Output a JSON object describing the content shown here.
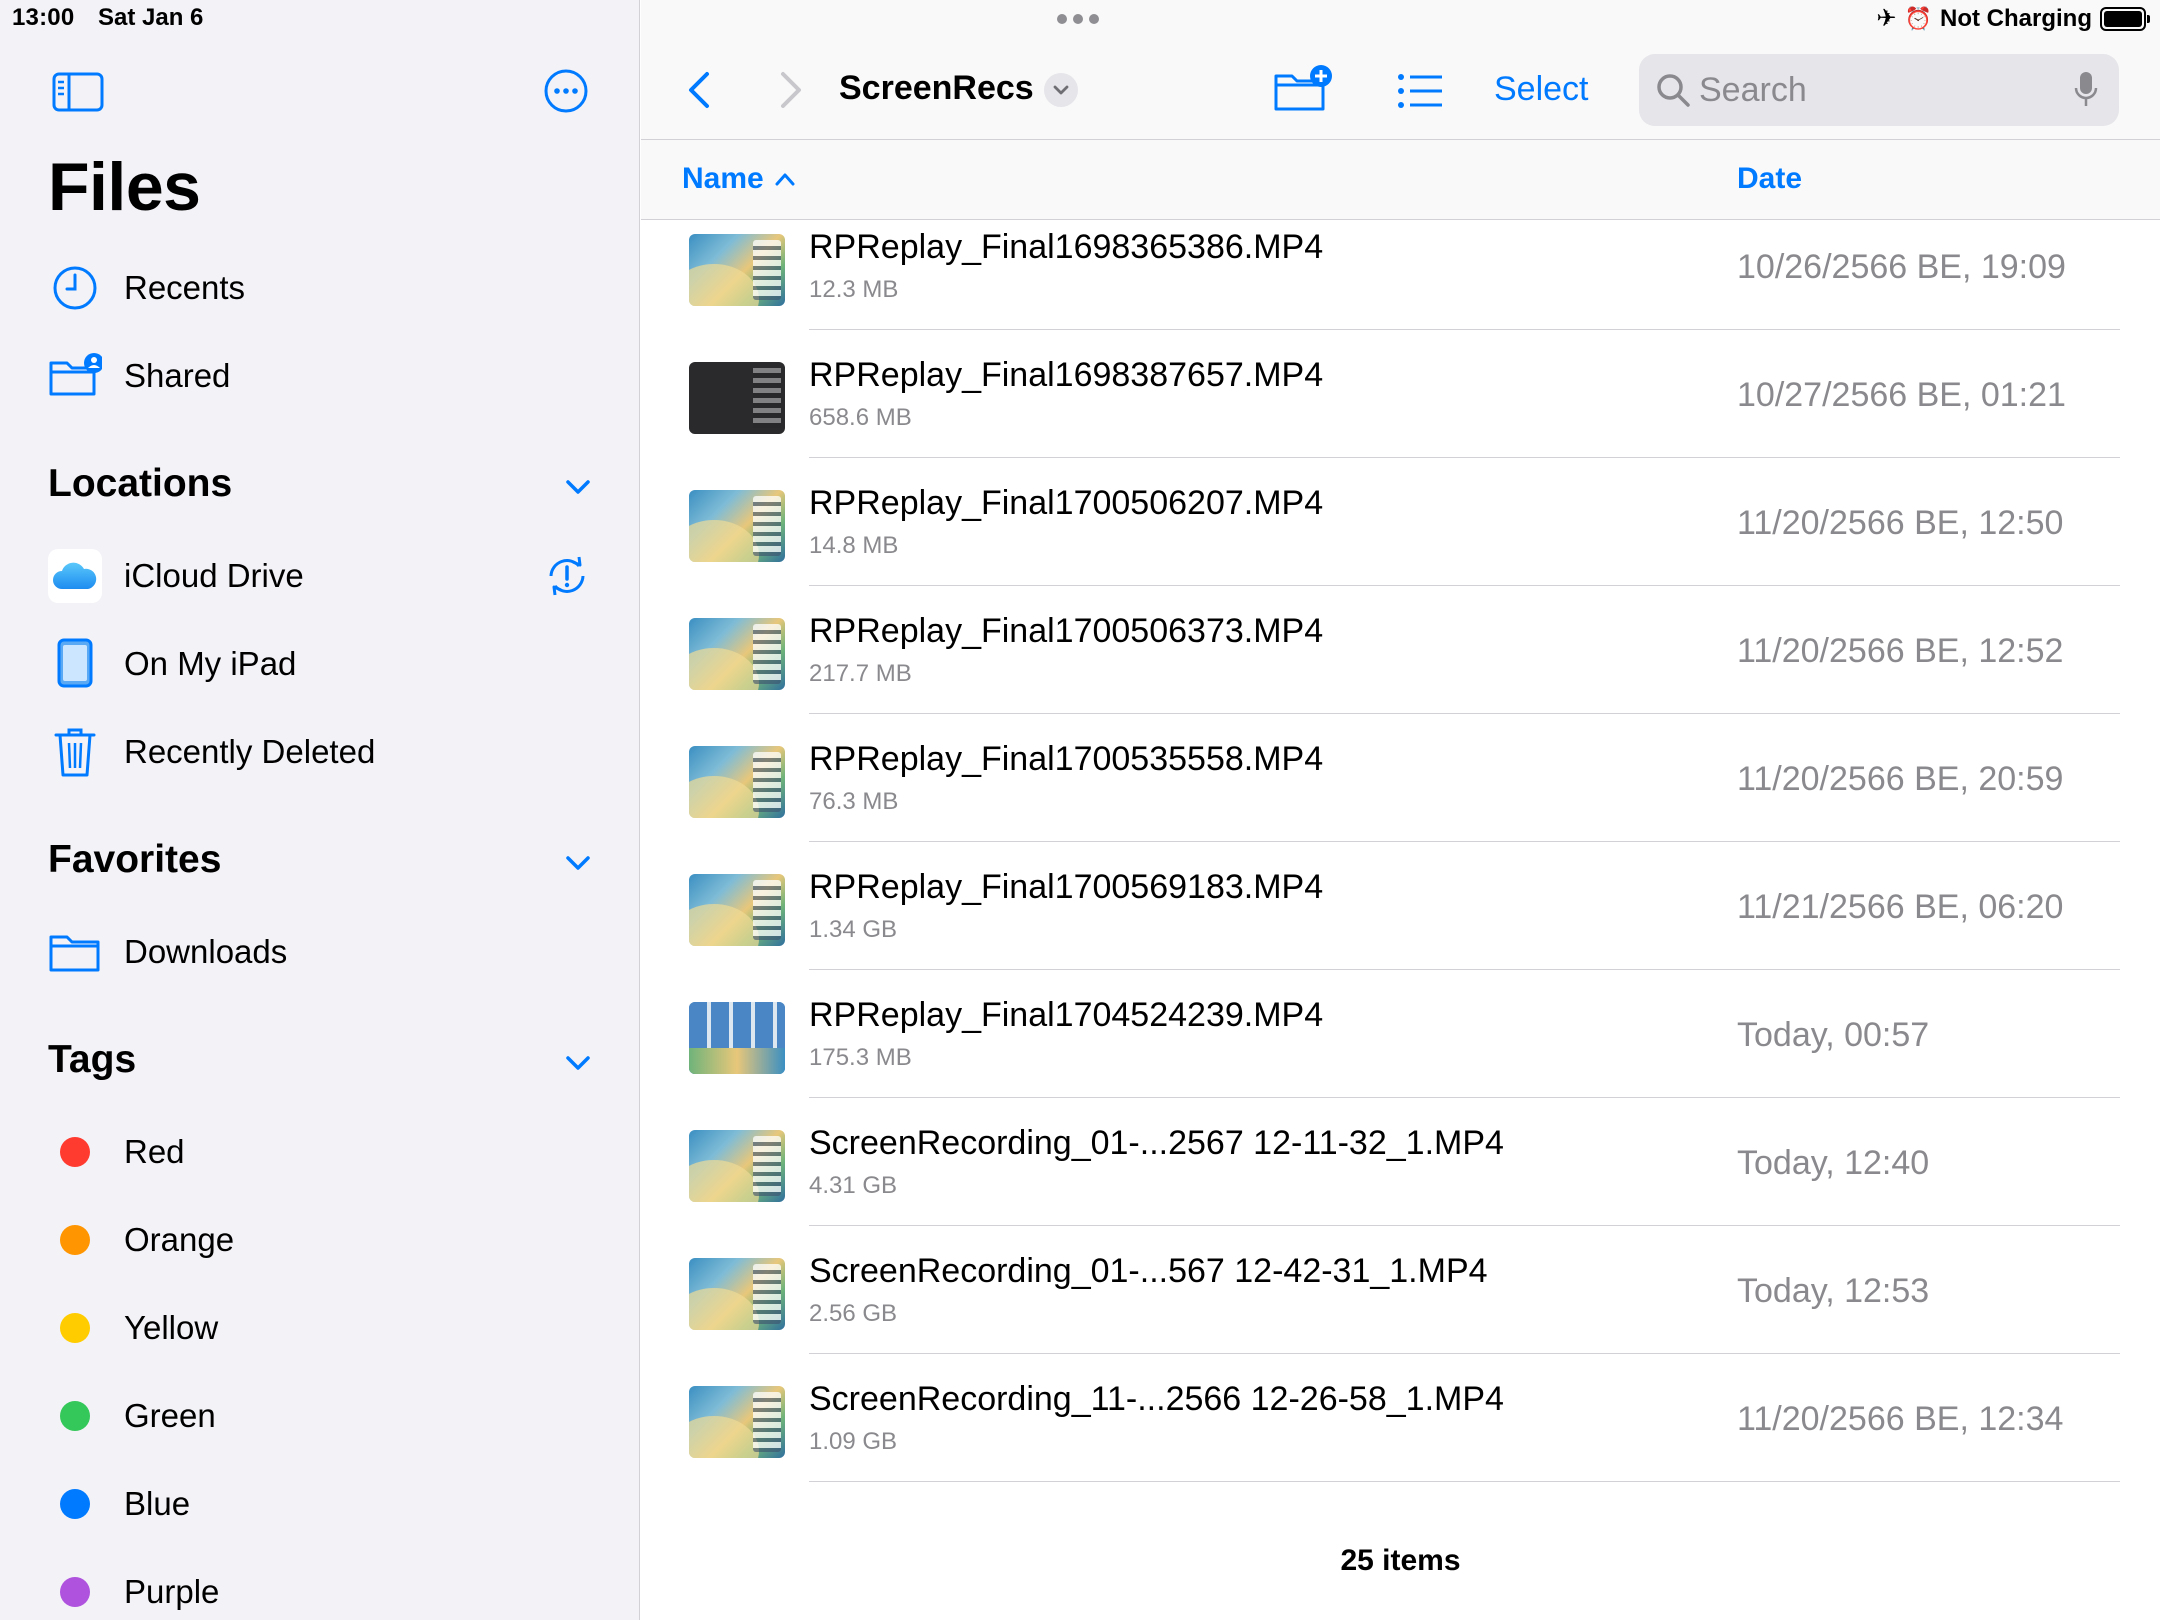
{
  "status": {
    "time": "13:00",
    "date": "Sat Jan 6",
    "charging": "Not Charging",
    "battery_level": 1.0
  },
  "sidebar": {
    "title": "Files",
    "top_items": [
      {
        "label": "Recents",
        "icon": "clock-icon"
      },
      {
        "label": "Shared",
        "icon": "shared-folder-icon"
      }
    ],
    "locations_header": "Locations",
    "locations": [
      {
        "label": "iCloud Drive",
        "icon": "icloud-icon"
      },
      {
        "label": "On My iPad",
        "icon": "ipad-icon"
      },
      {
        "label": "Recently Deleted",
        "icon": "trash-icon"
      }
    ],
    "favorites_header": "Favorites",
    "favorites": [
      {
        "label": "Downloads",
        "icon": "folder-icon"
      }
    ],
    "tags_header": "Tags",
    "tags": [
      {
        "label": "Red",
        "color": "#ff3b30"
      },
      {
        "label": "Orange",
        "color": "#ff9500"
      },
      {
        "label": "Yellow",
        "color": "#ffcc00"
      },
      {
        "label": "Green",
        "color": "#34c759"
      },
      {
        "label": "Blue",
        "color": "#007aff"
      },
      {
        "label": "Purple",
        "color": "#af52de"
      }
    ]
  },
  "toolbar": {
    "folder_title": "ScreenRecs",
    "select_label": "Select",
    "search_placeholder": "Search"
  },
  "columns": {
    "name": "Name",
    "date": "Date"
  },
  "files": [
    {
      "name": "RPReplay_Final1698365386.MP4",
      "size": "12.3 MB",
      "date": "10/26/2566 BE, 19:09",
      "thumb": "wallpaper"
    },
    {
      "name": "RPReplay_Final1698387657.MP4",
      "size": "658.6 MB",
      "date": "10/27/2566 BE, 01:21",
      "thumb": "dark"
    },
    {
      "name": "RPReplay_Final1700506207.MP4",
      "size": "14.8 MB",
      "date": "11/20/2566 BE, 12:50",
      "thumb": "wallpaper"
    },
    {
      "name": "RPReplay_Final1700506373.MP4",
      "size": "217.7 MB",
      "date": "11/20/2566 BE, 12:52",
      "thumb": "wallpaper"
    },
    {
      "name": "RPReplay_Final1700535558.MP4",
      "size": "76.3 MB",
      "date": "11/20/2566 BE, 20:59",
      "thumb": "wallpaper"
    },
    {
      "name": "RPReplay_Final1700569183.MP4",
      "size": "1.34 GB",
      "date": "11/21/2566 BE, 06:20",
      "thumb": "wallpaper"
    },
    {
      "name": "RPReplay_Final1704524239.MP4",
      "size": "175.3 MB",
      "date": "Today, 00:57",
      "thumb": "grid"
    },
    {
      "name": "ScreenRecording_01-...2567 12-11-32_1.MP4",
      "size": "4.31 GB",
      "date": "Today, 12:40",
      "thumb": "wallpaper"
    },
    {
      "name": "ScreenRecording_01-...567 12-42-31_1.MP4",
      "size": "2.56 GB",
      "date": "Today, 12:53",
      "thumb": "wallpaper"
    },
    {
      "name": "ScreenRecording_11-...2566 12-26-58_1.MP4",
      "size": "1.09 GB",
      "date": "11/20/2566 BE, 12:34",
      "thumb": "wallpaper"
    }
  ],
  "item_count": "25 items",
  "accent_color": "#007aff"
}
